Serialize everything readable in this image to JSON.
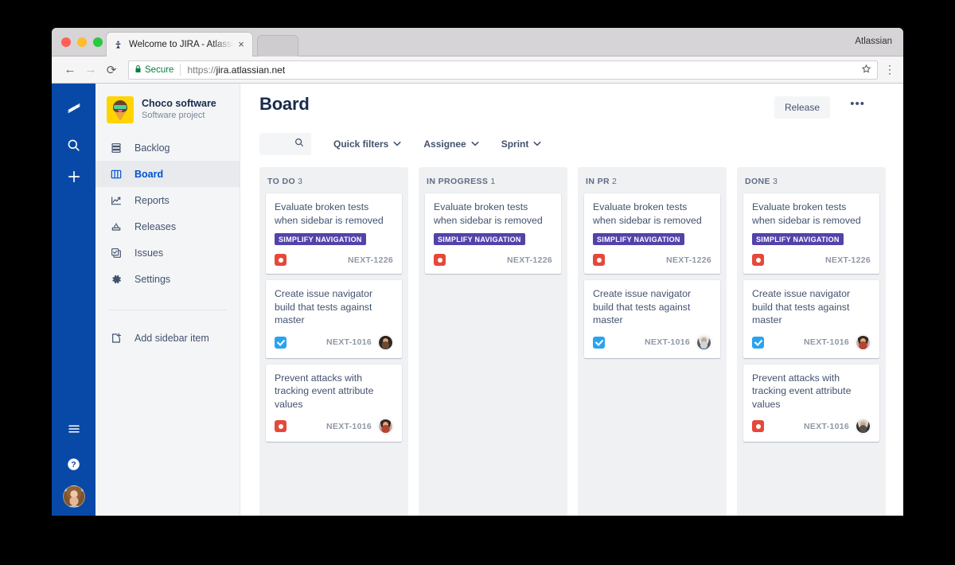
{
  "browser": {
    "tab": {
      "title": "Welcome to JIRA - Atlassian Fi",
      "favicon": "jira-favicon-icon",
      "close_label": "×"
    },
    "new_tab_label": "",
    "brand": "Atlassian",
    "nav": {
      "back": "←",
      "forward": "→",
      "reload": "⟳"
    },
    "omnibox": {
      "lock": "🔒",
      "secure_label": "Secure",
      "url_scheme": "https://",
      "url_host": "jira.atlassian.net",
      "star": "☆"
    },
    "menu_label": "⋮"
  },
  "global_nav": {
    "logo_name": "jira-logo-icon",
    "search_name": "search-icon",
    "create_name": "plus-icon",
    "menu_name": "hamburger-icon",
    "help_name": "help-icon",
    "avatar_name": "user-avatar"
  },
  "sidebar": {
    "project": {
      "name": "Choco software",
      "type": "Software project",
      "avatar_name": "project-avatar-icecream"
    },
    "items": [
      {
        "label": "Backlog",
        "icon": "backlog-icon",
        "selected": false
      },
      {
        "label": "Board",
        "icon": "board-icon",
        "selected": true
      },
      {
        "label": "Reports",
        "icon": "reports-icon",
        "selected": false
      },
      {
        "label": "Releases",
        "icon": "releases-icon",
        "selected": false
      },
      {
        "label": "Issues",
        "icon": "issues-icon",
        "selected": false
      },
      {
        "label": "Settings",
        "icon": "settings-icon",
        "selected": false
      }
    ],
    "add_item": {
      "label": "Add sidebar item",
      "icon": "add-item-icon"
    }
  },
  "header": {
    "title": "Board",
    "release_label": "Release",
    "more_label": "•••"
  },
  "toolbar": {
    "search_placeholder": "",
    "search_value": "",
    "search_icon": "search-icon",
    "filters": [
      {
        "label": "Quick filters",
        "caret": "∨"
      },
      {
        "label": "Assignee",
        "caret": "∨"
      },
      {
        "label": "Sprint",
        "caret": "∨"
      }
    ]
  },
  "board": {
    "columns": [
      {
        "name": "TO DO",
        "count": "3",
        "cards": [
          {
            "title": "Evaluate broken tests when sidebar is removed",
            "label": "SIMPLIFY NAVIGATION",
            "type": "bug",
            "key": "NEXT-1226",
            "avatar": null
          },
          {
            "title": "Create issue navigator build that tests against master",
            "label": null,
            "type": "task",
            "key": "NEXT-1016",
            "avatar": "av-2"
          },
          {
            "title": "Prevent attacks with tracking event attribute values",
            "label": null,
            "type": "bug",
            "key": "NEXT-1016",
            "avatar": "av-3"
          }
        ]
      },
      {
        "name": "IN PROGRESS",
        "count": "1",
        "cards": [
          {
            "title": "Evaluate broken tests when sidebar is removed",
            "label": "SIMPLIFY NAVIGATION",
            "type": "bug",
            "key": "NEXT-1226",
            "avatar": null
          }
        ]
      },
      {
        "name": "IN PR",
        "count": "2",
        "cards": [
          {
            "title": "Evaluate broken tests when sidebar is removed",
            "label": "SIMPLIFY NAVIGATION",
            "type": "bug",
            "key": "NEXT-1226",
            "avatar": null
          },
          {
            "title": "Create issue navigator build that tests against master",
            "label": null,
            "type": "task",
            "key": "NEXT-1016",
            "avatar": "av-1"
          }
        ]
      },
      {
        "name": "DONE",
        "count": "3",
        "cards": [
          {
            "title": "Evaluate broken tests when sidebar is removed",
            "label": "SIMPLIFY NAVIGATION",
            "type": "bug",
            "key": "NEXT-1226",
            "avatar": null
          },
          {
            "title": "Create issue navigator build that tests against master",
            "label": null,
            "type": "task",
            "key": "NEXT-1016",
            "avatar": "av-3"
          },
          {
            "title": "Prevent attacks with tracking event attribute values",
            "label": null,
            "type": "bug",
            "key": "NEXT-1016",
            "avatar": "av-4"
          }
        ]
      }
    ]
  },
  "colors": {
    "jira_blue": "#0849a7",
    "link_blue": "#0052cc",
    "label_purple": "#5243aa",
    "bug_red": "#e5493a",
    "task_blue": "#2aa3ef",
    "text_dark": "#172b4d",
    "text_muted": "#5e6c84",
    "project_avatar_yellow": "#ffd400",
    "secure_green": "#0b7f3f"
  }
}
